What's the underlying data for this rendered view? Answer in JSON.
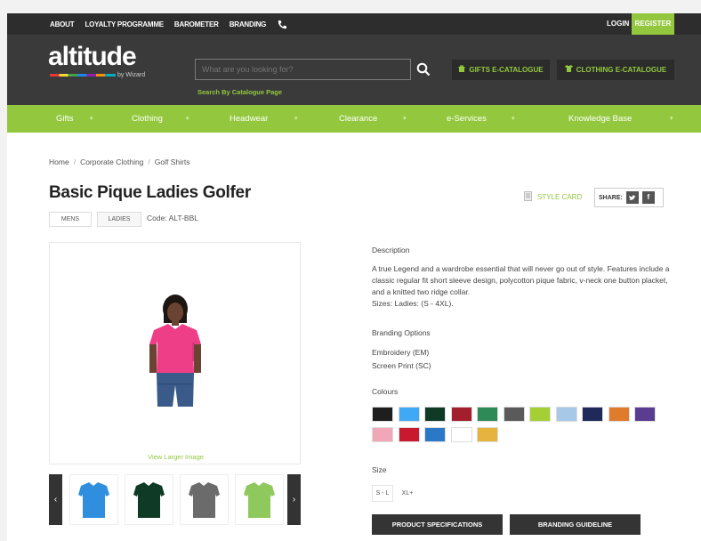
{
  "topbar": {
    "links": [
      "ABOUT",
      "LOYALTY PROGRAMME",
      "BAROMETER",
      "BRANDING"
    ],
    "login": "LOGIN",
    "register": "REGISTER"
  },
  "header": {
    "logo": "altitude",
    "logo_sub": "by Wizard",
    "search_placeholder": "What are you looking for?",
    "search_by_catalogue": "Search By Catalogue Page",
    "gifts_catalogue": "GIFTS E-CATALOGUE",
    "clothing_catalogue": "CLOTHING E-CATALOGUE"
  },
  "nav": [
    "Gifts",
    "Clothing",
    "Headwear",
    "Clearance",
    "e-Services",
    "Knowledge Base"
  ],
  "breadcrumb": [
    "Home",
    "Corporate Clothing",
    "Golf Shirts"
  ],
  "product": {
    "title": "Basic Pique Ladies Golfer",
    "tab_mens": "MENS",
    "tab_ladies": "LADIES",
    "code": "Code: ALT-BBL",
    "style_card": "STYLE CARD",
    "share": "SHARE:",
    "view_larger": "View Larger Image",
    "description_label": "Description",
    "description": "A true Legend and a wardrobe essential that will never go out of style. Features include a classic regular fit short sleeve design, polycotton pique fabric, v-neck one button placket, and a knitted two ridge collar.",
    "sizes_line": "Sizes: Ladies: (S - 4XL).",
    "branding_label": "Branding Options",
    "branding_options": [
      "Embroidery (EM)",
      "Screen Print (SC)"
    ],
    "colours_label": "Colours",
    "colours_row1": [
      "#1e1e1e",
      "#3fa9f5",
      "#0f3a26",
      "#a31f2e",
      "#2e8b57",
      "#5a5a5a",
      "#a4cf35",
      "#a8c8e8",
      "#1f2a5a",
      "#e07a2c",
      "#5a3d91"
    ],
    "colours_row2": [
      "#f1a7b8",
      "#c8192e",
      "#2b78c6",
      "#ffffff",
      "#e7b33f"
    ],
    "size_label": "Size",
    "sizes": [
      "S - L",
      "XL+"
    ],
    "btn_specs": "PRODUCT SPECIFICATIONS",
    "btn_branding": "BRANDING GUIDELINE",
    "thumb_colours": [
      "#2f8fde",
      "#0f3a26",
      "#6b6b6b",
      "#8fc85c"
    ]
  },
  "colors": {
    "accent": "#93c83e",
    "topbar": "#2d2d2d",
    "header": "#3a3a3a"
  }
}
